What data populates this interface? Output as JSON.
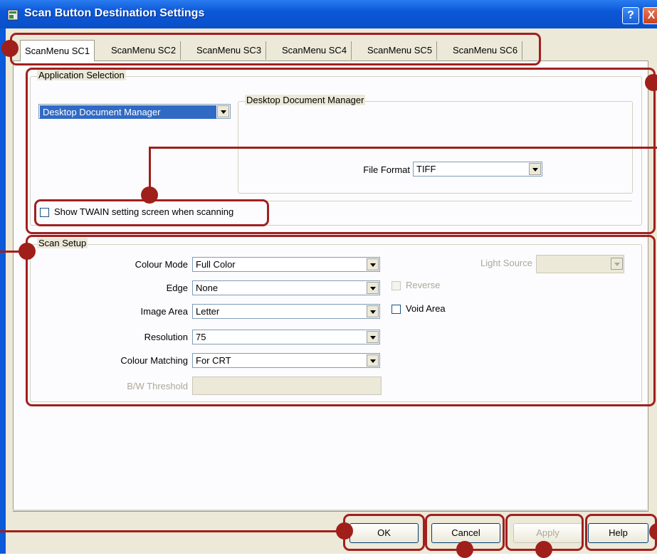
{
  "window": {
    "title": "Scan Button Destination Settings",
    "help_glyph": "?",
    "close_glyph": "X"
  },
  "tabs": [
    "ScanMenu SC1",
    "ScanMenu SC2",
    "ScanMenu SC3",
    "ScanMenu SC4",
    "ScanMenu SC5",
    "ScanMenu SC6"
  ],
  "app_selection": {
    "group_label": "Application Selection",
    "app_combo_value": "Desktop Document Manager",
    "sub_group_label": "Desktop Document Manager",
    "file_format_label": "File Format",
    "file_format_value": "TIFF",
    "twain_checkbox_label": "Show TWAIN setting screen when scanning"
  },
  "scan_setup": {
    "group_label": "Scan Setup",
    "colour_mode_label": "Colour Mode",
    "colour_mode_value": "Full Color",
    "edge_label": "Edge",
    "edge_value": "None",
    "image_area_label": "Image Area",
    "image_area_value": "Letter",
    "resolution_label": "Resolution",
    "resolution_value": "75",
    "colour_matching_label": "Colour Matching",
    "colour_matching_value": "For CRT",
    "bw_threshold_label": "B/W Threshold",
    "light_source_label": "Light Source",
    "reverse_label": "Reverse",
    "void_area_label": "Void Area"
  },
  "buttons": {
    "ok": "OK",
    "cancel": "Cancel",
    "apply": "Apply",
    "help": "Help"
  },
  "colors": {
    "title_bar": "#0a5ad9",
    "dialog_bg": "#ece9d8",
    "callout": "#a01f1a",
    "selection": "#316ac5"
  }
}
